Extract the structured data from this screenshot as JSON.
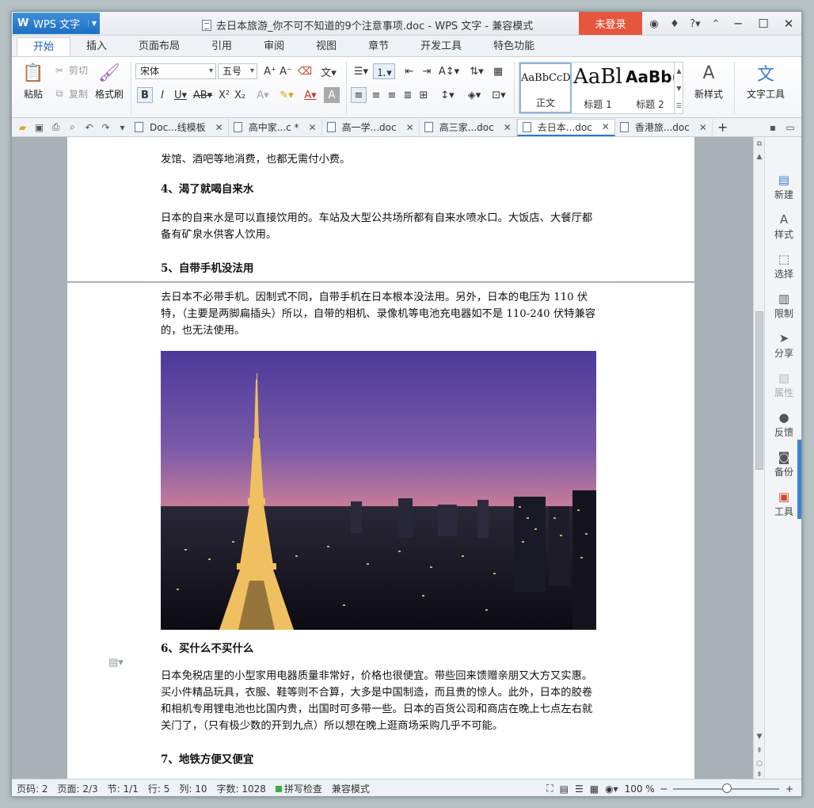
{
  "app": {
    "name": "WPS 文字",
    "window_title": "去日本旅游_你不可不知道的9个注意事项.doc - WPS 文字 - 兼容模式",
    "login_label": "未登录"
  },
  "ribbon_tabs": [
    "开始",
    "插入",
    "页面布局",
    "引用",
    "审阅",
    "视图",
    "章节",
    "开发工具",
    "特色功能"
  ],
  "ribbon": {
    "paste": "粘贴",
    "cut": "剪切",
    "copy": "复制",
    "format_painter": "格式刷",
    "font_name": "宋体",
    "font_size": "五号",
    "styles": [
      {
        "sample": "AaBbCcD",
        "name": "正文"
      },
      {
        "sample": "AaBl",
        "name": "标题 1"
      },
      {
        "sample": "AaBb(",
        "name": "标题 2"
      }
    ],
    "new_style": "新样式",
    "text_tools": "文字工具"
  },
  "doc_tabs": [
    {
      "label": "Doc...线模板",
      "active": false
    },
    {
      "label": "高中家...c *",
      "active": false
    },
    {
      "label": "高一学...doc",
      "active": false
    },
    {
      "label": "高三家...doc",
      "active": false
    },
    {
      "label": "去日本...doc",
      "active": true
    },
    {
      "label": "香港旅...doc",
      "active": false
    }
  ],
  "document": {
    "p_top": "发馆、酒吧等地消费，也都无需付小费。",
    "h4": "4、渴了就喝自来水",
    "p4": "日本的自来水是可以直接饮用的。车站及大型公共场所都有自来水喷水口。大饭店、大餐厅都备有矿泉水供客人饮用。",
    "h5": "5、自带手机没法用",
    "p5": "去日本不必带手机。因制式不同，自带手机在日本根本没法用。另外，日本的电压为 110 伏特，（主要是两脚扁插头）所以，自带的相机、录像机等电池充电器如不是 110-240 伏特兼容的，也无法使用。",
    "h6": "6、买什么不买什么",
    "p6": "日本免税店里的小型家用电器质量非常好，价格也很便宜。带些回来馈赠亲朋又大方又实惠。买小件精品玩具，衣服、鞋等则不合算，大多是中国制造，而且贵的惊人。此外，日本的胶卷和相机专用锂电池也比国内贵，出国时可多带一些。日本的百货公司和商店在晚上七点左右就关门了，（只有极少数的开到九点）所以想在晚上逛商场采购几乎不可能。",
    "h7": "7、地铁方便又便宜"
  },
  "task_pane": [
    "新建",
    "样式",
    "选择",
    "限制",
    "分享",
    "属性",
    "反馈",
    "备份",
    "工具"
  ],
  "status": {
    "page_code": "页码: 2",
    "pages": "页面: 2/3",
    "section": "节: 1/1",
    "row": "行: 5",
    "col": "列: 10",
    "words": "字数: 1028",
    "spell": "拼写检查",
    "mode": "兼容模式",
    "zoom": "100 %"
  },
  "colors": {
    "accent": "#2b78d0",
    "login": "#e4573d",
    "page_bg": "#a9b1b6"
  }
}
